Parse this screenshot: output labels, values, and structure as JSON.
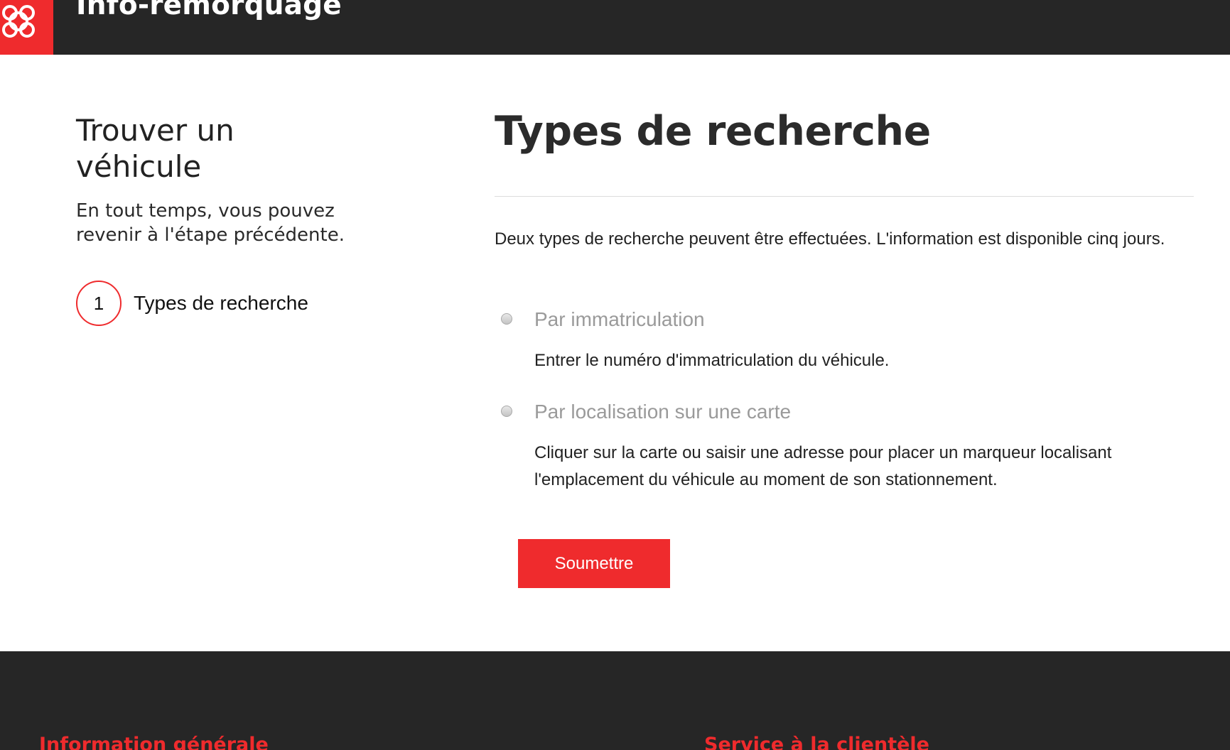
{
  "header": {
    "site_title": "Info-remorquage",
    "brand_color": "#ef2b2d",
    "logo_icon": "montreal-rosette-logo"
  },
  "sidebar": {
    "title": "Trouver un véhicule",
    "description": "En tout temps, vous pouvez revenir à l'étape précédente.",
    "steps": [
      {
        "number": "1",
        "label": "Types de recherche"
      }
    ]
  },
  "main": {
    "title": "Types de recherche",
    "intro": "Deux types de recherche peuvent être effectuées. L'information est disponible cinq jours.",
    "options": [
      {
        "label": "Par immatriculation",
        "description": "Entrer le numéro d'immatriculation du véhicule.",
        "selected": false
      },
      {
        "label": "Par localisation sur une carte",
        "description": "Cliquer sur la carte ou saisir une adresse pour placer un marqueur localisant l'emplacement du véhicule au moment de son stationnement.",
        "selected": false
      }
    ],
    "submit_label": "Soumettre"
  },
  "footer": {
    "headings": [
      "Information générale",
      "Service à la clientèle"
    ]
  }
}
